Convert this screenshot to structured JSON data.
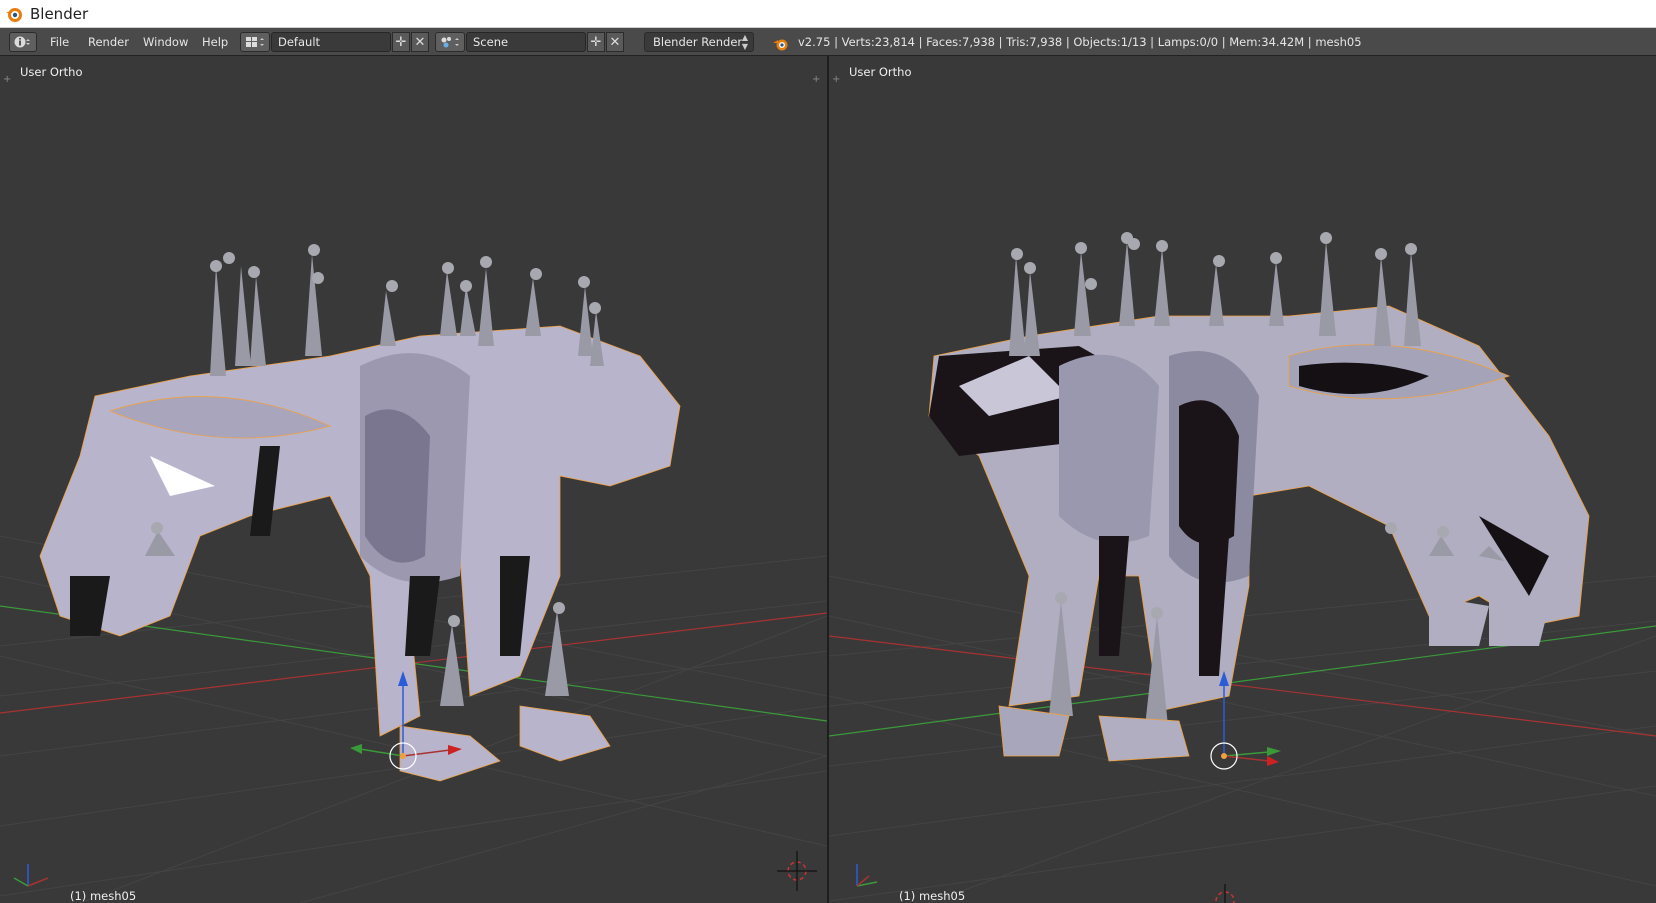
{
  "window": {
    "title": "Blender"
  },
  "infobar": {
    "menus": [
      "File",
      "Render",
      "Window",
      "Help"
    ],
    "layout": "Default",
    "scene": "Scene",
    "engine": "Blender Render",
    "stats": "v2.75 | Verts:23,814 | Faces:7,938 | Tris:7,938 | Objects:1/13 | Lamps:0/0 | Mem:34.42M | mesh05"
  },
  "viewports": [
    {
      "label": "User Ortho",
      "object": "(1) mesh05"
    },
    {
      "label": "User Ortho",
      "object": "(1) mesh05"
    }
  ],
  "icons": {
    "app": "blender-logo-icon",
    "info": "info-editor-icon",
    "layout": "screen-layout-icon",
    "scene": "scene-icon",
    "add": "add-icon",
    "close": "close-icon",
    "engine": "render-engine-icon",
    "cursor": "3d-cursor-icon"
  },
  "colors": {
    "grid": "#444444",
    "axis_x": "#a83232",
    "axis_y": "#3a9a3a",
    "axis_z": "#2b5cd8",
    "selection": "#f0a040",
    "mesh": "#b8b4cc"
  }
}
